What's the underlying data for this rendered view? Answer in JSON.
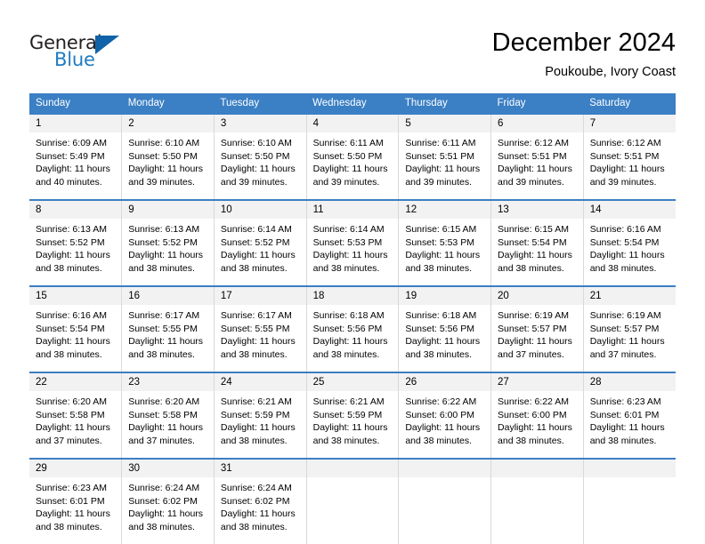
{
  "brand": {
    "name_part1": "General",
    "name_part2": "Blue",
    "triangle_icon": "triangle-icon",
    "accent_color": "#1063a8",
    "blue_text_color": "#1f7bc1"
  },
  "header": {
    "title": "December 2024",
    "subtitle": "Poukoube, Ivory Coast"
  },
  "theme": {
    "header_row_bg": "#3b7fc4",
    "day_number_bg": "#f2f2f2",
    "cell_border": "#d9d9d9",
    "text_color": "#000000"
  },
  "weekdays": [
    "Sunday",
    "Monday",
    "Tuesday",
    "Wednesday",
    "Thursday",
    "Friday",
    "Saturday"
  ],
  "weeks": [
    [
      {
        "day": "1",
        "sunrise": "Sunrise: 6:09 AM",
        "sunset": "Sunset: 5:49 PM",
        "daylight1": "Daylight: 11 hours",
        "daylight2": "and 40 minutes."
      },
      {
        "day": "2",
        "sunrise": "Sunrise: 6:10 AM",
        "sunset": "Sunset: 5:50 PM",
        "daylight1": "Daylight: 11 hours",
        "daylight2": "and 39 minutes."
      },
      {
        "day": "3",
        "sunrise": "Sunrise: 6:10 AM",
        "sunset": "Sunset: 5:50 PM",
        "daylight1": "Daylight: 11 hours",
        "daylight2": "and 39 minutes."
      },
      {
        "day": "4",
        "sunrise": "Sunrise: 6:11 AM",
        "sunset": "Sunset: 5:50 PM",
        "daylight1": "Daylight: 11 hours",
        "daylight2": "and 39 minutes."
      },
      {
        "day": "5",
        "sunrise": "Sunrise: 6:11 AM",
        "sunset": "Sunset: 5:51 PM",
        "daylight1": "Daylight: 11 hours",
        "daylight2": "and 39 minutes."
      },
      {
        "day": "6",
        "sunrise": "Sunrise: 6:12 AM",
        "sunset": "Sunset: 5:51 PM",
        "daylight1": "Daylight: 11 hours",
        "daylight2": "and 39 minutes."
      },
      {
        "day": "7",
        "sunrise": "Sunrise: 6:12 AM",
        "sunset": "Sunset: 5:51 PM",
        "daylight1": "Daylight: 11 hours",
        "daylight2": "and 39 minutes."
      }
    ],
    [
      {
        "day": "8",
        "sunrise": "Sunrise: 6:13 AM",
        "sunset": "Sunset: 5:52 PM",
        "daylight1": "Daylight: 11 hours",
        "daylight2": "and 38 minutes."
      },
      {
        "day": "9",
        "sunrise": "Sunrise: 6:13 AM",
        "sunset": "Sunset: 5:52 PM",
        "daylight1": "Daylight: 11 hours",
        "daylight2": "and 38 minutes."
      },
      {
        "day": "10",
        "sunrise": "Sunrise: 6:14 AM",
        "sunset": "Sunset: 5:52 PM",
        "daylight1": "Daylight: 11 hours",
        "daylight2": "and 38 minutes."
      },
      {
        "day": "11",
        "sunrise": "Sunrise: 6:14 AM",
        "sunset": "Sunset: 5:53 PM",
        "daylight1": "Daylight: 11 hours",
        "daylight2": "and 38 minutes."
      },
      {
        "day": "12",
        "sunrise": "Sunrise: 6:15 AM",
        "sunset": "Sunset: 5:53 PM",
        "daylight1": "Daylight: 11 hours",
        "daylight2": "and 38 minutes."
      },
      {
        "day": "13",
        "sunrise": "Sunrise: 6:15 AM",
        "sunset": "Sunset: 5:54 PM",
        "daylight1": "Daylight: 11 hours",
        "daylight2": "and 38 minutes."
      },
      {
        "day": "14",
        "sunrise": "Sunrise: 6:16 AM",
        "sunset": "Sunset: 5:54 PM",
        "daylight1": "Daylight: 11 hours",
        "daylight2": "and 38 minutes."
      }
    ],
    [
      {
        "day": "15",
        "sunrise": "Sunrise: 6:16 AM",
        "sunset": "Sunset: 5:54 PM",
        "daylight1": "Daylight: 11 hours",
        "daylight2": "and 38 minutes."
      },
      {
        "day": "16",
        "sunrise": "Sunrise: 6:17 AM",
        "sunset": "Sunset: 5:55 PM",
        "daylight1": "Daylight: 11 hours",
        "daylight2": "and 38 minutes."
      },
      {
        "day": "17",
        "sunrise": "Sunrise: 6:17 AM",
        "sunset": "Sunset: 5:55 PM",
        "daylight1": "Daylight: 11 hours",
        "daylight2": "and 38 minutes."
      },
      {
        "day": "18",
        "sunrise": "Sunrise: 6:18 AM",
        "sunset": "Sunset: 5:56 PM",
        "daylight1": "Daylight: 11 hours",
        "daylight2": "and 38 minutes."
      },
      {
        "day": "19",
        "sunrise": "Sunrise: 6:18 AM",
        "sunset": "Sunset: 5:56 PM",
        "daylight1": "Daylight: 11 hours",
        "daylight2": "and 38 minutes."
      },
      {
        "day": "20",
        "sunrise": "Sunrise: 6:19 AM",
        "sunset": "Sunset: 5:57 PM",
        "daylight1": "Daylight: 11 hours",
        "daylight2": "and 37 minutes."
      },
      {
        "day": "21",
        "sunrise": "Sunrise: 6:19 AM",
        "sunset": "Sunset: 5:57 PM",
        "daylight1": "Daylight: 11 hours",
        "daylight2": "and 37 minutes."
      }
    ],
    [
      {
        "day": "22",
        "sunrise": "Sunrise: 6:20 AM",
        "sunset": "Sunset: 5:58 PM",
        "daylight1": "Daylight: 11 hours",
        "daylight2": "and 37 minutes."
      },
      {
        "day": "23",
        "sunrise": "Sunrise: 6:20 AM",
        "sunset": "Sunset: 5:58 PM",
        "daylight1": "Daylight: 11 hours",
        "daylight2": "and 37 minutes."
      },
      {
        "day": "24",
        "sunrise": "Sunrise: 6:21 AM",
        "sunset": "Sunset: 5:59 PM",
        "daylight1": "Daylight: 11 hours",
        "daylight2": "and 38 minutes."
      },
      {
        "day": "25",
        "sunrise": "Sunrise: 6:21 AM",
        "sunset": "Sunset: 5:59 PM",
        "daylight1": "Daylight: 11 hours",
        "daylight2": "and 38 minutes."
      },
      {
        "day": "26",
        "sunrise": "Sunrise: 6:22 AM",
        "sunset": "Sunset: 6:00 PM",
        "daylight1": "Daylight: 11 hours",
        "daylight2": "and 38 minutes."
      },
      {
        "day": "27",
        "sunrise": "Sunrise: 6:22 AM",
        "sunset": "Sunset: 6:00 PM",
        "daylight1": "Daylight: 11 hours",
        "daylight2": "and 38 minutes."
      },
      {
        "day": "28",
        "sunrise": "Sunrise: 6:23 AM",
        "sunset": "Sunset: 6:01 PM",
        "daylight1": "Daylight: 11 hours",
        "daylight2": "and 38 minutes."
      }
    ],
    [
      {
        "day": "29",
        "sunrise": "Sunrise: 6:23 AM",
        "sunset": "Sunset: 6:01 PM",
        "daylight1": "Daylight: 11 hours",
        "daylight2": "and 38 minutes."
      },
      {
        "day": "30",
        "sunrise": "Sunrise: 6:24 AM",
        "sunset": "Sunset: 6:02 PM",
        "daylight1": "Daylight: 11 hours",
        "daylight2": "and 38 minutes."
      },
      {
        "day": "31",
        "sunrise": "Sunrise: 6:24 AM",
        "sunset": "Sunset: 6:02 PM",
        "daylight1": "Daylight: 11 hours",
        "daylight2": "and 38 minutes."
      },
      {
        "day": "",
        "sunrise": "",
        "sunset": "",
        "daylight1": "",
        "daylight2": ""
      },
      {
        "day": "",
        "sunrise": "",
        "sunset": "",
        "daylight1": "",
        "daylight2": ""
      },
      {
        "day": "",
        "sunrise": "",
        "sunset": "",
        "daylight1": "",
        "daylight2": ""
      },
      {
        "day": "",
        "sunrise": "",
        "sunset": "",
        "daylight1": "",
        "daylight2": ""
      }
    ]
  ]
}
